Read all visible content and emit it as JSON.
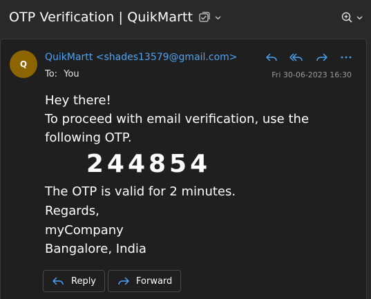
{
  "header": {
    "subject": "OTP Verification | QuikMartt"
  },
  "message": {
    "avatar_initial": "Q",
    "sender": "QuikMartt <shades13579@gmail.com>",
    "to_prefix": "To:",
    "to_value": "You",
    "date": "Fri 30-06-2023 16:30",
    "body": {
      "greeting": "Hey there!",
      "line1": "To proceed with email verification, use the",
      "line2": "following OTP.",
      "otp": "244854",
      "validity": "The OTP is valid for 2 minutes.",
      "signoff": "Regards,",
      "company": "myCompany",
      "location": "Bangalore, India"
    }
  },
  "actions": {
    "reply_label": "Reply",
    "forward_label": "Forward"
  },
  "colors": {
    "accent": "#4ea3f5",
    "avatar": "#8d6500",
    "background": "#292929",
    "card": "#1f1f1f"
  },
  "icons": {
    "tag": "tag-check-icon",
    "zoom": "zoom-in-icon",
    "reply": "reply-icon",
    "reply_all": "reply-all-icon",
    "forward": "forward-icon",
    "more": "more-icon"
  }
}
